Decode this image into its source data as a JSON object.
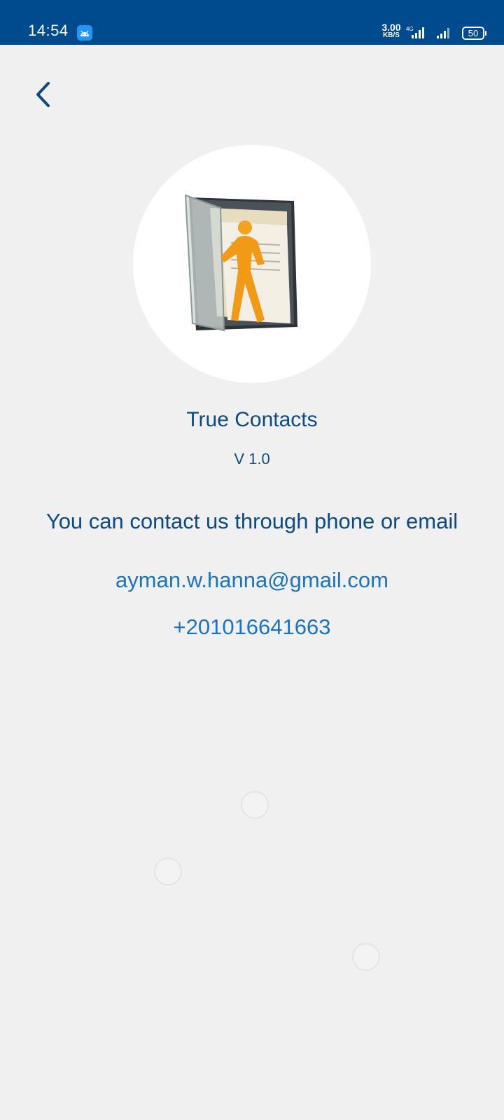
{
  "status_bar": {
    "time": "14:54",
    "net_speed": "3.00",
    "net_speed_unit": "KB/S",
    "network_type": "4G",
    "battery": "50"
  },
  "nav": {
    "back_icon": "chevron-left-icon"
  },
  "about": {
    "app_name": "True Contacts",
    "version": "V 1.0",
    "contact_text": "You can contact us through phone or email",
    "email": "ayman.w.hanna@gmail.com",
    "phone": "+201016641663"
  },
  "colors": {
    "status_bar": "#004b8d",
    "primary_text": "#0b4a86",
    "link_text": "#1a73c4",
    "background": "#f0f0f0"
  }
}
